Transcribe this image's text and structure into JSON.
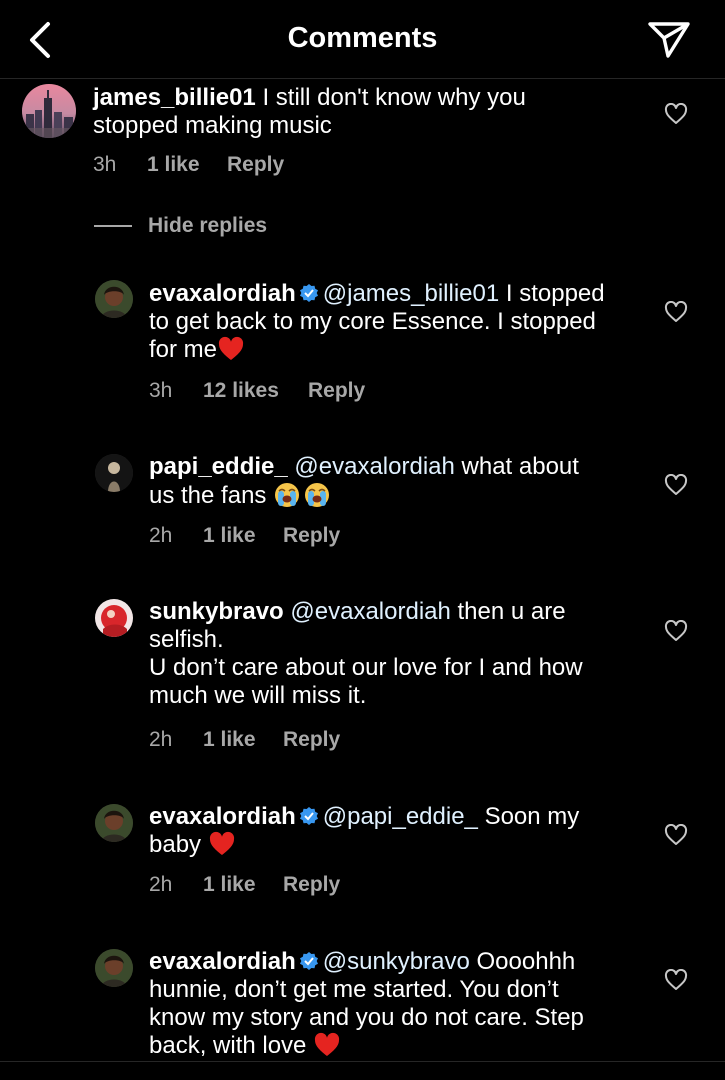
{
  "header": {
    "title": "Comments"
  },
  "comments": [
    {
      "username": "james_billie01",
      "lines": [
        "I still don't know why you",
        "stopped making music"
      ],
      "time": "3h",
      "likes": "1 like",
      "reply": "Reply"
    },
    {
      "username": "evaxalordiah",
      "mention": "@james_billie01",
      "lines": [
        "I stopped",
        "to get back to my core Essence. I stopped",
        "for me"
      ],
      "time": "3h",
      "likes": "12 likes",
      "reply": "Reply"
    },
    {
      "username": "papi_eddie_",
      "mention": "@evaxalordiah",
      "lines": [
        "what about",
        "us the fans"
      ],
      "time": "2h",
      "likes": "1 like",
      "reply": "Reply"
    },
    {
      "username": "sunkybravo",
      "mention": "@evaxalordiah",
      "lines": [
        "then u are",
        "selfish.",
        "U don’t care about our love for I and how",
        "much we will miss it."
      ],
      "time": "2h",
      "likes": "1 like",
      "reply": "Reply"
    },
    {
      "username": "evaxalordiah",
      "mention": "@papi_eddie_",
      "lines": [
        "Soon my",
        "baby"
      ],
      "time": "2h",
      "likes": "1 like",
      "reply": "Reply"
    },
    {
      "username": "evaxalordiah",
      "mention": "@sunkybravo",
      "lines": [
        "Oooohhh",
        "hunnie, don’t get me started. You don’t",
        "know my story and you do not care. Step",
        "back, with love"
      ]
    }
  ],
  "hide_replies": "Hide replies",
  "icons": {
    "back": "chevron-left-icon",
    "send": "paper-plane-icon",
    "like": "heart-outline-icon",
    "verified": "verified-badge-icon",
    "verified_color": "#3897f0",
    "heart_emoji_color": "#e52420"
  }
}
